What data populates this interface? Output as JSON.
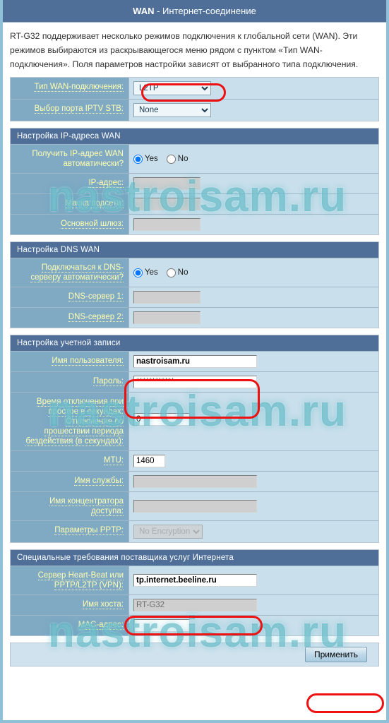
{
  "page": {
    "title_strong": "WAN",
    "title_rest": " - Интернет-соединение",
    "intro": "RT-G32 поддерживает несколько режимов подключения к глобальной сети (WAN). Эти режимов выбираются из раскрывающегося меню рядом с пунктом «Тип WAN-подключения». Поля параметров настройки зависят от выбранного типа подключения.",
    "watermark": "nastroisam.ru",
    "accent_header": "#4f6f98",
    "label_bg": "#80a9c4",
    "value_bg": "#c9dfeb",
    "label_text": "#ffffb0",
    "highlight": "#ee1111"
  },
  "top": {
    "wan_type_label": "Тип WAN-подключения:",
    "wan_type_value": "L2TP",
    "iptv_label": "Выбор порта IPTV STB:",
    "iptv_value": "None"
  },
  "ip_section": {
    "header": "Настройка IP-адреса WAN",
    "auto_ip_label_line1": "Получить IP-адрес WAN",
    "auto_ip_label_line2": "автоматически?",
    "yes": "Yes",
    "no": "No",
    "auto_ip_selected": "Yes",
    "ip_label": "IP-адрес:",
    "ip_value": "",
    "mask_label": "Маска подсети:",
    "mask_value": "",
    "gateway_label": "Основной шлюз:",
    "gateway_value": ""
  },
  "dns_section": {
    "header": "Настройка DNS WAN",
    "auto_dns_label_line1": "Подключаться к DNS-",
    "auto_dns_label_line2": "серверу автоматически?",
    "yes": "Yes",
    "no": "No",
    "auto_dns_selected": "Yes",
    "dns1_label": "DNS-сервер 1:",
    "dns1_value": "",
    "dns2_label": "DNS-сервер 2:",
    "dns2_value": ""
  },
  "account_section": {
    "header": "Настройка учетной записи",
    "user_label": "Имя пользователя:",
    "user_value": "nastroisam.ru",
    "pass_label": "Пароль:",
    "pass_value": "************",
    "idle_label_line1": "Время отключения при",
    "idle_label_line2": "простое в секундах:",
    "idle_label_line3": "Отключение по",
    "idle_label_line4": "прошествии периода",
    "idle_label_line5": "бездействия (в секундах):",
    "idle_value": "0",
    "mtu_label": "MTU:",
    "mtu_value": "1460",
    "service_label": "Имя службы:",
    "service_value": "",
    "concentrator_label_line1": "Имя концентратора",
    "concentrator_label_line2": "доступа:",
    "concentrator_value": "",
    "pptp_label": "Параметры PPTP:",
    "pptp_value": "No Encryption"
  },
  "isp_section": {
    "header": "Специальные требования поставщика услуг Интернета",
    "heartbeat_label_line1": "Сервер Heart-Beat или",
    "heartbeat_label_line2": "PPTP/L2TP (VPN):",
    "heartbeat_value": "tp.internet.beeline.ru",
    "hostname_label": "Имя хоста:",
    "hostname_value": "RT-G32",
    "mac_label": "MAC-адрес:",
    "mac_value": ""
  },
  "footer": {
    "apply_label": "Применить"
  }
}
